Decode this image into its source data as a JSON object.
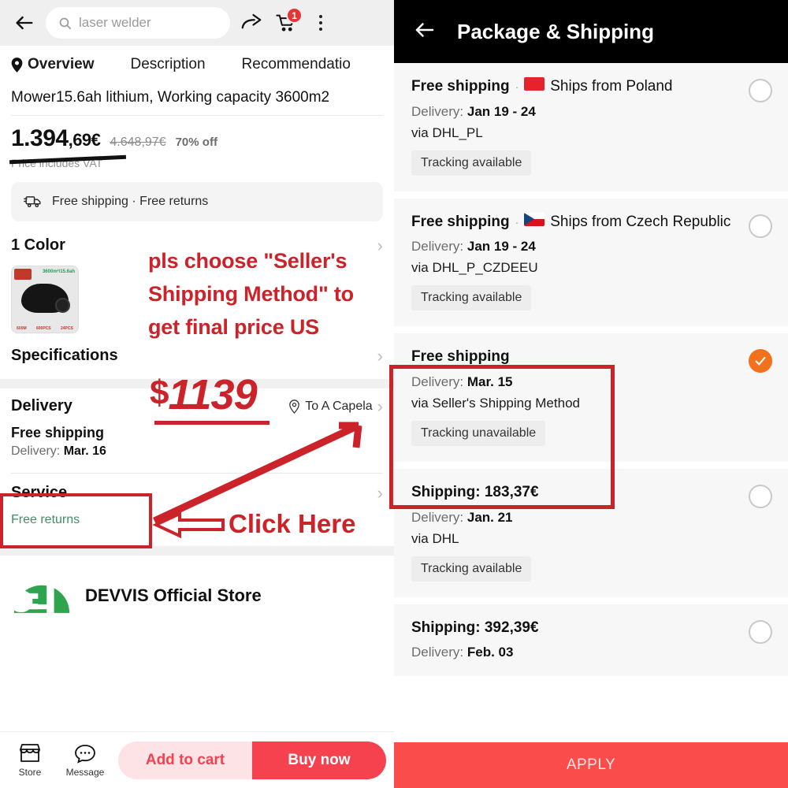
{
  "product_page": {
    "topbar": {
      "back_icon": "back-arrow-icon",
      "search_value": "laser welder",
      "search_placeholder": "laser welder",
      "share_icon": "share-icon",
      "cart_icon": "cart-icon",
      "cart_badge": "1",
      "more_icon": "more-options-icon"
    },
    "tabs": [
      {
        "label": "Overview",
        "active": true,
        "icon": "location-pin-icon"
      },
      {
        "label": "Description",
        "active": false
      },
      {
        "label": "Recommendatio",
        "active": false
      }
    ],
    "title": "Mower15.6ah lithium, Working capacity 3600m2",
    "price": {
      "current_main": "1.394",
      "current_cents": ",69€",
      "original": "4.648,97€",
      "discount": "70% off",
      "vat_note": "Price includes VAT"
    },
    "shipping_chip": "Free shipping · Free returns",
    "color_section": {
      "label": "1 Color",
      "swatch_top_text": "3600m²/15.6ah",
      "swatch_b1": "600M",
      "swatch_b2": "600PCS",
      "swatch_b3": "24PCS"
    },
    "specifications_label": "Specifications",
    "delivery": {
      "label": "Delivery",
      "location": "To A Capela",
      "location_icon": "location-pin-icon",
      "shipping_title": "Free shipping",
      "delivery_prefix": "Delivery: ",
      "delivery_date": "Mar. 16"
    },
    "service": {
      "label": "Service",
      "value": "Free returns"
    },
    "store": {
      "name": "DEVVIS Official Store"
    },
    "bottombar": {
      "store_label": "Store",
      "store_icon": "storefront-icon",
      "message_label": "Message",
      "message_icon": "chat-bubble-icon",
      "add_to_cart": "Add to cart",
      "buy_now": "Buy now"
    }
  },
  "annotations": {
    "instruction_line1": "pls choose \"Seller's",
    "instruction_line2": "Shipping Method\" to",
    "instruction_line3": "get final price US",
    "price_dollar": "$",
    "price_value": "1139",
    "click_here": "Click Here",
    "color_red": "#cc2229"
  },
  "shipping_sheet": {
    "header": {
      "back_icon": "back-arrow-icon",
      "title": "Package & Shipping"
    },
    "options": [
      {
        "price_label": "Free shipping",
        "separator": "·",
        "flag": "flag-poland",
        "ships_from": "Ships from Poland",
        "delivery_prefix": "Delivery: ",
        "delivery_value": "Jan 19 - 24",
        "via": "via DHL_PL",
        "tracking": "Tracking available",
        "selected": false,
        "highlighted": false
      },
      {
        "price_label": "Free shipping",
        "separator": "·",
        "flag": "flag-czech",
        "ships_from": "Ships from Czech Republic",
        "delivery_prefix": "Delivery: ",
        "delivery_value": "Jan 19 - 24",
        "via": "via DHL_P_CZDEEU",
        "tracking": "Tracking available",
        "selected": false,
        "highlighted": false
      },
      {
        "price_label": "Free shipping",
        "separator": "",
        "flag": "",
        "ships_from": "",
        "delivery_prefix": "Delivery: ",
        "delivery_value": "Mar. 15",
        "via": "via Seller's Shipping Method",
        "tracking": "Tracking unavailable",
        "selected": true,
        "highlighted": true
      },
      {
        "price_label": "Shipping: 183,37€",
        "separator": "",
        "flag": "",
        "ships_from": "",
        "delivery_prefix": "Delivery: ",
        "delivery_value": "Jan. 21",
        "via": "via DHL",
        "tracking": "Tracking available",
        "selected": false,
        "highlighted": false
      },
      {
        "price_label": "Shipping: 392,39€",
        "separator": "",
        "flag": "",
        "ships_from": "",
        "delivery_prefix": "Delivery: ",
        "delivery_value": "Feb. 03",
        "via": "",
        "tracking": "",
        "selected": false,
        "highlighted": false
      }
    ],
    "apply_label": "APPLY",
    "selected_color": "#f2711c",
    "apply_color": "#fb4c4c"
  }
}
